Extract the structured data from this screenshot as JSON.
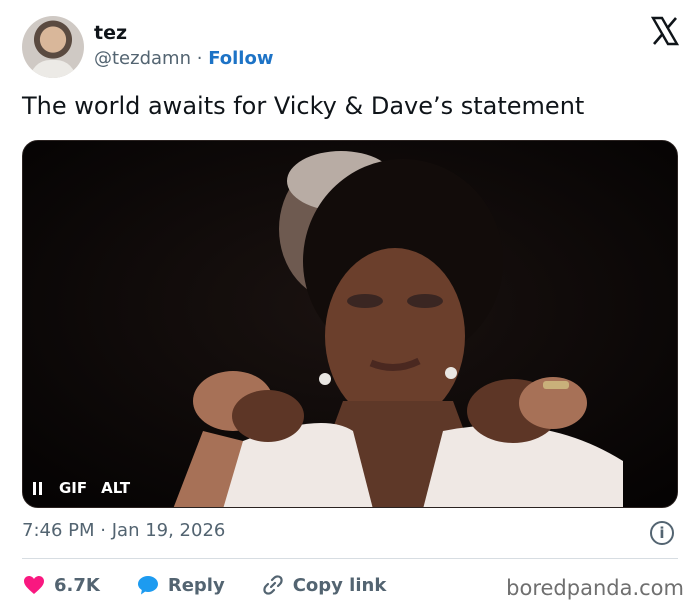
{
  "author": {
    "name": "tez",
    "handle": "@tezdamn",
    "separator": "·",
    "follow_label": "Follow"
  },
  "brand_icon": "x-logo-icon",
  "tweet": {
    "text": "The world awaits for Vicky & Dave’s statement"
  },
  "media": {
    "type_badge": "GIF",
    "alt_badge": "ALT",
    "state_icon": "pause-icon"
  },
  "meta": {
    "time": "7:46 PM",
    "separator": "·",
    "date": "Jan 19, 2026",
    "info_icon": "info-icon"
  },
  "actions": {
    "likes": "6.7K",
    "reply_label": "Reply",
    "copy_link_label": "Copy link"
  },
  "colors": {
    "follow": "#1d73c6",
    "like": "#f91880",
    "reply": "#1d9bf0",
    "muted": "#536471"
  },
  "watermark": "boredpanda.com"
}
